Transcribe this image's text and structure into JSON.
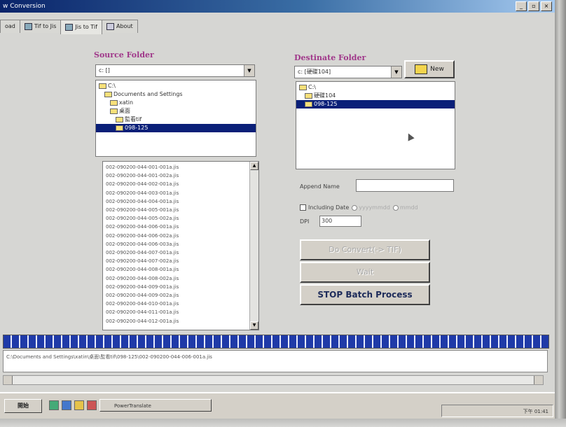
{
  "window": {
    "title": "w Conversion",
    "controls": [
      "_",
      "▫",
      "×"
    ]
  },
  "tabs": [
    {
      "label": "oad"
    },
    {
      "label": "Tif to Jis"
    },
    {
      "label": "Jis to Tif"
    },
    {
      "label": "About"
    }
  ],
  "source": {
    "heading": "Source Folder",
    "drive": "c: []",
    "tree": [
      {
        "label": "C:\\",
        "indent": 0
      },
      {
        "label": "Documents and Settings",
        "indent": 1
      },
      {
        "label": "xatin",
        "indent": 2
      },
      {
        "label": "桌面",
        "indent": 2
      },
      {
        "label": "監看tif",
        "indent": 3
      },
      {
        "label": "098-125",
        "indent": 3,
        "selected": true
      }
    ],
    "files": [
      "002-090200-044-001-001a.jis",
      "002-090200-044-001-002a.jis",
      "002-090200-044-002-001a.jis",
      "002-090200-044-003-001a.jis",
      "002-090200-044-004-001a.jis",
      "002-090200-044-005-001a.jis",
      "002-090200-044-005-002a.jis",
      "002-090200-044-006-001a.jis",
      "002-090200-044-006-002a.jis",
      "002-090200-044-006-003a.jis",
      "002-090200-044-007-001a.jis",
      "002-090200-044-007-002a.jis",
      "002-090200-044-008-001a.jis",
      "002-090200-044-008-002a.jis",
      "002-090200-044-009-001a.jis",
      "002-090200-044-009-002a.jis",
      "002-090200-044-010-001a.jis",
      "002-090200-044-011-001a.jis",
      "002-090200-044-012-001a.jis"
    ]
  },
  "destination": {
    "heading": "Destinate Folder",
    "drive": "c: [硬碟104]",
    "new_label": "New",
    "tree": [
      {
        "label": "C:\\",
        "indent": 0
      },
      {
        "label": "硬碟104",
        "indent": 1
      },
      {
        "label": "098-125",
        "indent": 1,
        "selected": true
      }
    ]
  },
  "options": {
    "append_label": "Append Name",
    "append_value": "",
    "including_date_label": "Including Date",
    "date_fmt_1": "yyyymmdd",
    "date_fmt_2": "mmdd",
    "dpi_label": "DPI",
    "dpi_value": "300"
  },
  "actions": {
    "convert_label": "Do Convert(-> TIF)",
    "wait_label": "Wait",
    "stop_label": "STOP Batch Process"
  },
  "progress": {
    "fraction": 1.0
  },
  "status": {
    "path": "C:\\Documents and Settings\\xatin\\桌面\\監看tif\\098-125\\002-090200-044-006-001a.jis"
  },
  "taskbar": {
    "start_label": "開始",
    "task_label": "PowerTranslate",
    "clock": "下午 01:41"
  }
}
